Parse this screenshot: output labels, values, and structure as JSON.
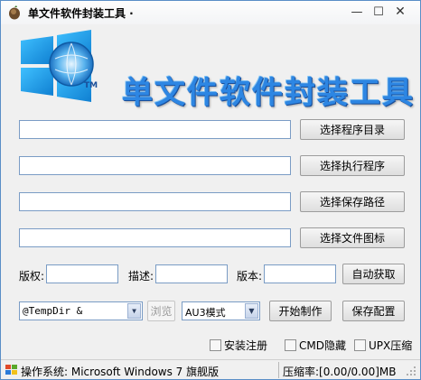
{
  "window": {
    "title": "单文件软件封装工具 ·",
    "controls": {
      "minimize": "—",
      "maximize": "☐",
      "close": "✕"
    }
  },
  "banner": {
    "text": "单文件软件封装工具",
    "tm": "TM"
  },
  "paths": {
    "program_dir": {
      "value": "",
      "button": "选择程序目录"
    },
    "executable": {
      "value": "",
      "button": "选择执行程序"
    },
    "save_path": {
      "value": "",
      "button": "选择保存路径"
    },
    "file_icon": {
      "value": "",
      "button": "选择文件图标"
    }
  },
  "meta": {
    "copyright_label": "版权:",
    "copyright_value": "",
    "description_label": "描述:",
    "description_value": "",
    "version_label": "版本:",
    "version_value": "",
    "auto_fetch_button": "自动获取"
  },
  "options": {
    "temp_dir_value": "@TempDir &",
    "browse_button": "浏览",
    "mode_value": "AU3模式",
    "start_button": "开始制作",
    "save_config_button": "保存配置"
  },
  "checks": {
    "install_register": {
      "label": "安装注册",
      "checked": false
    },
    "cmd_hidden": {
      "label": "CMD隐藏",
      "checked": false
    },
    "upx_compress": {
      "label": "UPX压缩",
      "checked": false
    }
  },
  "status": {
    "os": "操作系统: Microsoft Windows 7 旗舰版",
    "compression": "压缩率:[0.00/0.00]MB"
  },
  "colors": {
    "banner_blue": "#2d86e3",
    "logo_blue": "#1aa1e8",
    "field_border": "#7a9cc5"
  }
}
